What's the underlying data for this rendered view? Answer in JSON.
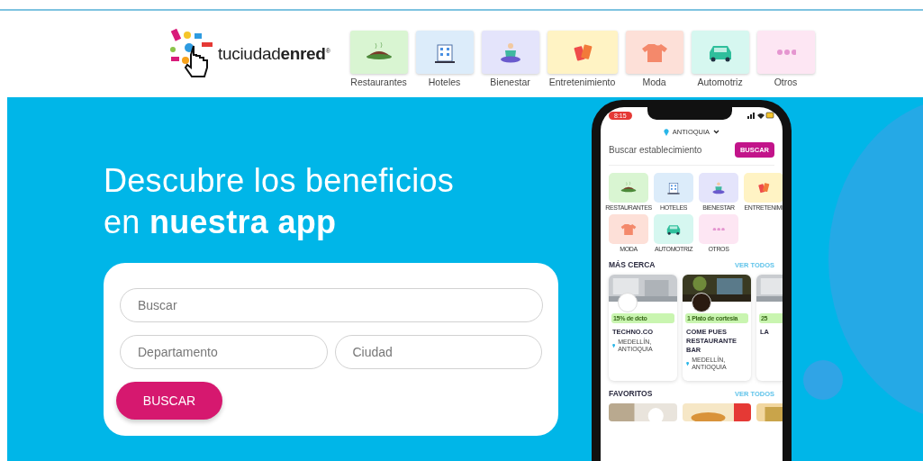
{
  "header": {
    "logo": "tuciudad**enred**$^{®}$",
    "categories": [
      {
        "label": "Restaurantes",
        "color": "#d9f5d2"
      },
      {
        "label": "Hoteles",
        "color": "#dcecfa"
      },
      {
        "label": "Bienestar",
        "color": "#e4e4fb"
      },
      {
        "label": "Entretenimiento",
        "color": "#fff3c4"
      },
      {
        "label": "Moda",
        "color": "#fde0d8"
      },
      {
        "label": "Automotriz",
        "color": "#d6f7f0"
      },
      {
        "label": "Otros",
        "color": "#fde6f3"
      }
    ]
  },
  "hero": {
    "title": [
      "Descubre los beneficios",
      "en **nuestra app**"
    ],
    "form": {
      "search": {
        "placeholder": "Buscar"
      },
      "department": {
        "placeholder": "Departamento"
      },
      "city": {
        "placeholder": "Ciudad"
      },
      "button": "BUSCAR"
    }
  },
  "phone": {
    "time": "8:15",
    "location": "ANTIOQUIA",
    "search": {
      "placeholder": "Buscar establecimiento"
    },
    "search_button": "BUSCAR",
    "categories": [
      {
        "label": "RESTAURANTES",
        "color": "#d9f5d2"
      },
      {
        "label": "HOTELES",
        "color": "#dcecfa"
      },
      {
        "label": "BIENESTAR",
        "color": "#e4e4fb"
      },
      {
        "label": "ENTRETENIMI",
        "color": "#fff3c4"
      },
      {
        "label": "MODA",
        "color": "#fde0d8"
      },
      {
        "label": "AUTOMOTRIZ",
        "color": "#d6f7f0"
      },
      {
        "label": "OTROS",
        "color": "#fde6f3"
      }
    ],
    "nearby": {
      "title": "MÁS CERCA",
      "link": "VER TODOS",
      "cards": [
        {
          "badge": "15% de dcto",
          "name": "TECHNO.CO",
          "place": "MEDELLÍN, ANTIOQUIA"
        },
        {
          "badge": "1 Plato de cortesia",
          "name": "COME PUES RESTAURANTE BAR",
          "place": "MEDELLÍN, ANTIOQUIA"
        },
        {
          "badge": "25",
          "name": "LA"
        }
      ]
    },
    "favorites": {
      "title": "FAVORITOS",
      "link": "VER TODOS"
    }
  }
}
